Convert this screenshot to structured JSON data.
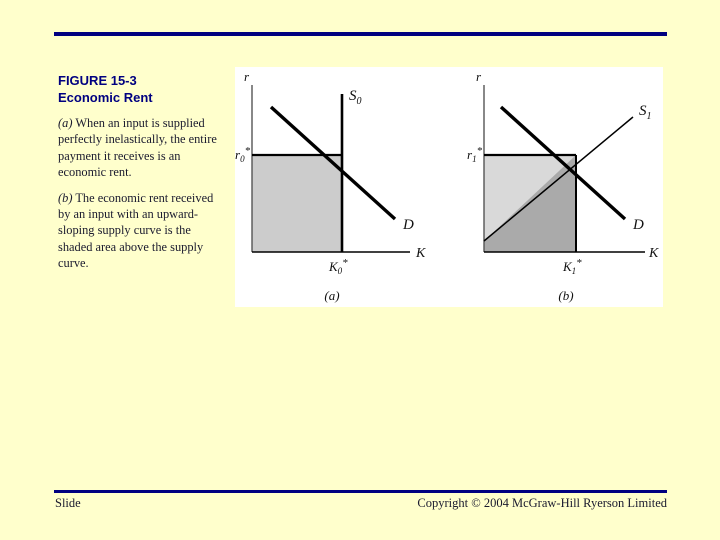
{
  "slide": {
    "background_color": "#FFFFCC",
    "rule_color": "#000080"
  },
  "figure_caption": {
    "number": "FIGURE 15-3",
    "title": "Economic Rent",
    "paragraph_a_marker": "(a)",
    "paragraph_a": " When an input is supplied perfectly inelastically, the entire payment it receives is an economic rent.",
    "paragraph_b_marker": "(b)",
    "paragraph_b": " The economic rent received by an input with an upward-sloping supply curve is the shaded area above the supply curve."
  },
  "footer": {
    "left": "Slide",
    "right": "Copyright © 2004 McGraw-Hill Ryerson Limited"
  },
  "chart_data": [
    {
      "type": "line",
      "title": "(a)",
      "panel_label": "(a)",
      "xlabel": "K",
      "ylabel": "r",
      "xlim": [
        0,
        100
      ],
      "ylim": [
        0,
        100
      ],
      "grid": false,
      "legend": "inline-labels",
      "series": [
        {
          "name": "D",
          "label": "D",
          "description": "Downward-sloping demand curve",
          "x": [
            12,
            94
          ],
          "y": [
            92,
            22
          ]
        },
        {
          "name": "S0",
          "label": "S₀",
          "description": "Perfectly inelastic (vertical) supply curve at K0*",
          "x": [
            56,
            56
          ],
          "y": [
            0,
            100
          ]
        }
      ],
      "equilibrium": {
        "price_label": "r₀*",
        "quantity_label": "K₀*",
        "x": 56,
        "y": 57
      },
      "shaded_regions": [
        {
          "name": "economic-rent",
          "shape": "rectangle",
          "color": "#CCCCCC",
          "description": "Entire payment rectangle r0* x K0* is economic rent"
        }
      ]
    },
    {
      "type": "line",
      "title": "(b)",
      "panel_label": "(b)",
      "xlabel": "K",
      "ylabel": "r",
      "xlim": [
        0,
        100
      ],
      "ylim": [
        0,
        100
      ],
      "grid": false,
      "legend": "inline-labels",
      "series": [
        {
          "name": "D",
          "label": "D",
          "description": "Downward-sloping demand curve",
          "x": [
            14,
            92
          ],
          "y": [
            93,
            22
          ]
        },
        {
          "name": "S1",
          "label": "S₁",
          "description": "Upward-sloping supply curve",
          "x": [
            0,
            96
          ],
          "y": [
            12,
            88
          ]
        }
      ],
      "equilibrium": {
        "price_label": "r₁*",
        "quantity_label": "K₁*",
        "x": 57,
        "y": 57
      },
      "shaded_regions": [
        {
          "name": "economic-rent",
          "shape": "triangle-above-supply",
          "color": "#D9D9D9",
          "description": "Light shaded area above supply curve is economic rent"
        },
        {
          "name": "opportunity-cost",
          "shape": "area-below-supply",
          "color": "#AAAAAA",
          "description": "Darker shaded area below supply curve is opportunity cost / transfer earnings"
        }
      ]
    }
  ]
}
